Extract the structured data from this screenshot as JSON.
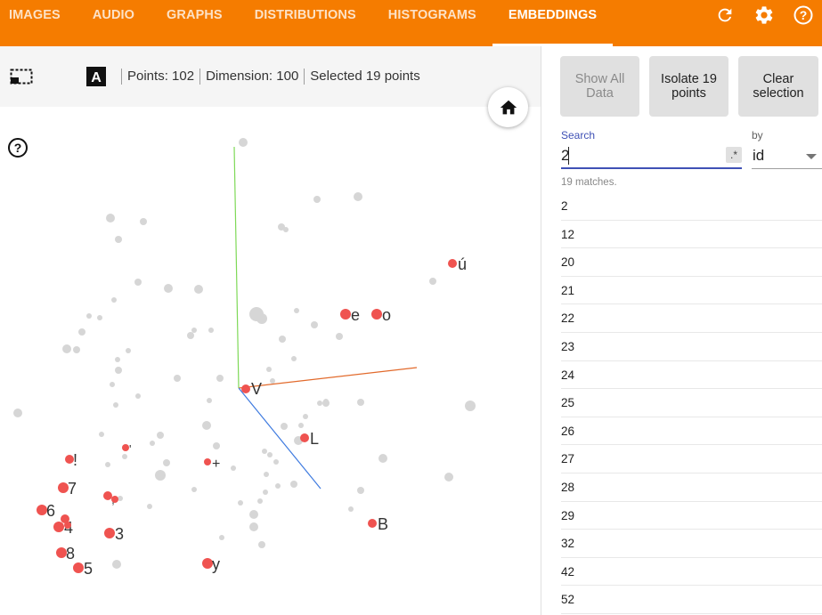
{
  "tabs": [
    {
      "label": "IMAGES"
    },
    {
      "label": "AUDIO"
    },
    {
      "label": "GRAPHS"
    },
    {
      "label": "DISTRIBUTIONS"
    },
    {
      "label": "HISTOGRAMS"
    },
    {
      "label": "EMBEDDINGS",
      "active": true
    }
  ],
  "top_icons": [
    "refresh-icon",
    "settings-gear-icon",
    "help-circle-icon"
  ],
  "toolbar": {
    "icons": [
      "bounding-box-select-icon",
      "night-mode-icon",
      "label-toggle-icon"
    ],
    "points": "Points: 102",
    "dimension": "Dimension: 100",
    "selected": "Selected 19 points"
  },
  "panel": {
    "show_all": "Show All Data",
    "isolate": "Isolate 19 points",
    "clear": "Clear selection",
    "search_label": "Search",
    "search_value": "2",
    "regex_label": ".*",
    "by_label": "by",
    "by_value": "id",
    "matches": "19 matches.",
    "results": [
      "2",
      "12",
      "20",
      "21",
      "22",
      "23",
      "24",
      "25",
      "26",
      "27",
      "28",
      "29",
      "32",
      "42",
      "52"
    ]
  },
  "colors": {
    "accent": "#f57c00",
    "selected_point": "#ef5350",
    "unselected_point": "#d6d6d6",
    "axis_x": "#e26a2c",
    "axis_y": "#7ed957",
    "axis_z": "#3f7be0"
  },
  "projection": {
    "selected_labels": [
      "ú",
      "e",
      "o",
      "V",
      "L",
      "!",
      "7",
      ",",
      "+",
      "6",
      "4",
      "3",
      "B",
      "8",
      "5",
      "y",
      "'"
    ]
  }
}
